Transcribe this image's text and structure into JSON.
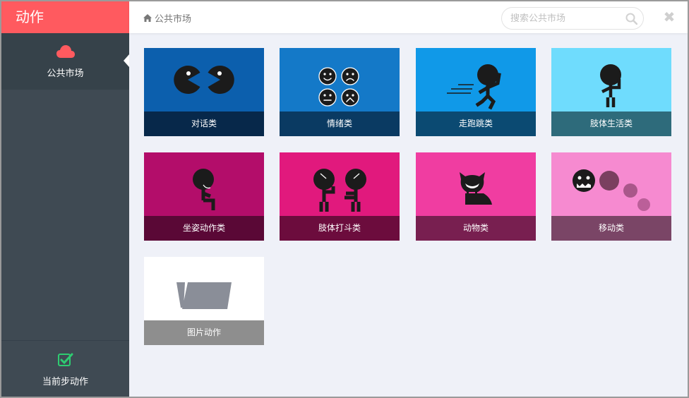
{
  "sidebar": {
    "title": "动作",
    "items": [
      {
        "label": "公共市场",
        "icon": "cloud-icon"
      }
    ],
    "footer": {
      "label": "当前步动作",
      "icon": "checkbox-checked-icon"
    }
  },
  "topbar": {
    "breadcrumb": "公共市场",
    "search_placeholder": "搜索公共市场"
  },
  "colors": {
    "brand": "#ff5a5f",
    "sidebar": "#3f4a53",
    "content_bg": "#eff1f8"
  },
  "cards": [
    {
      "label": "对话类",
      "art": "#0c5fad",
      "bar": "#07284a"
    },
    {
      "label": "情绪类",
      "art": "#1479c8",
      "bar": "#0a3a62"
    },
    {
      "label": "走跑跳类",
      "art": "#1099e8",
      "bar": "#0b4a72"
    },
    {
      "label": "肢体生活类",
      "art": "#6fdcfd",
      "bar": "#2e6b7b"
    },
    {
      "label": "坐姿动作类",
      "art": "#b30d6a",
      "bar": "#5a0836"
    },
    {
      "label": "肢体打斗类",
      "art": "#e1197d",
      "bar": "#6c0c3d"
    },
    {
      "label": "动物类",
      "art": "#f03da1",
      "bar": "#781f50"
    },
    {
      "label": "移动类",
      "art": "#f68ad0",
      "bar": "#7a4566"
    },
    {
      "label": "图片动作",
      "art": "#ffffff",
      "bar": "#8e8e8e"
    }
  ]
}
